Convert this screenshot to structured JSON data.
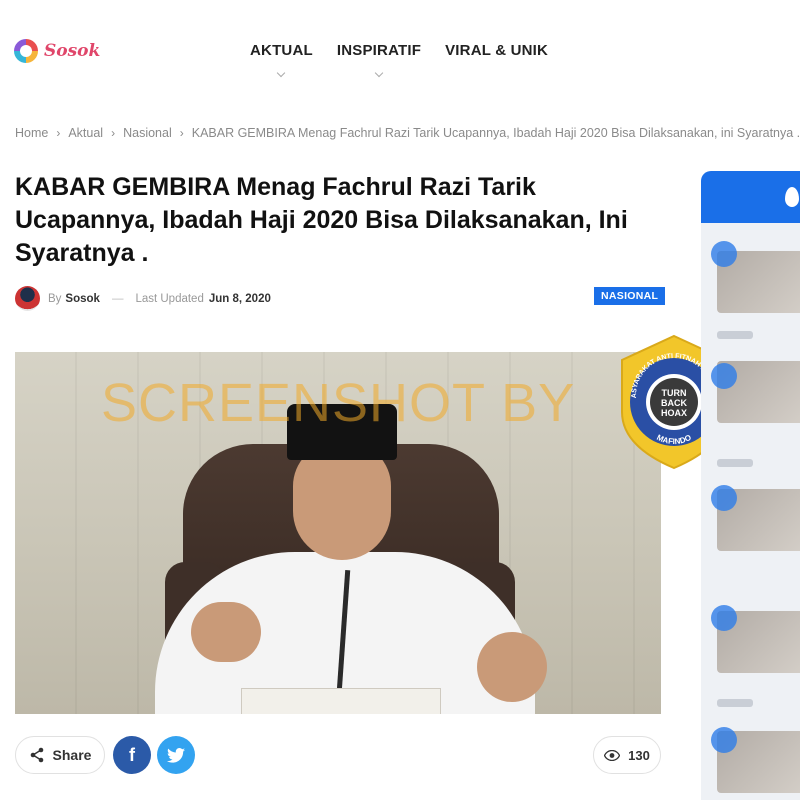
{
  "site": {
    "logo_text": "Sosok"
  },
  "nav": {
    "items": [
      {
        "label": "AKTUAL",
        "has_dropdown": true
      },
      {
        "label": "INSPIRATIF",
        "has_dropdown": true
      },
      {
        "label": "VIRAL & UNIK",
        "has_dropdown": false
      }
    ]
  },
  "breadcrumb": {
    "items": [
      "Home",
      "Aktual",
      "Nasional",
      "KABAR GEMBIRA Menag Fachrul Razi Tarik Ucapannya, Ibadah Haji 2020 Bisa Dilaksanakan, ini Syaratnya ."
    ]
  },
  "article": {
    "title": "KABAR GEMBIRA Menag Fachrul Razi Tarik Ucapannya, Ibadah Haji 2020 Bisa Dilaksanakan, Ini Syaratnya .",
    "by_label": "By",
    "author": "Sosok",
    "dash": "—",
    "updated_label": "Last Updated",
    "updated_date": "Jun 8, 2020",
    "category": "NASIONAL",
    "watermark": "SCREENSHOT BY"
  },
  "stamp": {
    "top_text": "MASYARAKAT ANTI FITNAH INDONESIA",
    "center_lines": [
      "TURN",
      "BACK",
      "HOAX"
    ],
    "bottom_text": "MAFINDO"
  },
  "share": {
    "share_label": "Share",
    "facebook_glyph": "f",
    "views_count": "130"
  },
  "colors": {
    "accent_blue": "#1a6fe8",
    "facebook": "#2b5aa8",
    "twitter": "#33a3f0",
    "watermark": "#f0aa28",
    "stamp_yellow": "#f2c62a",
    "stamp_blue": "#2a4fa5"
  }
}
